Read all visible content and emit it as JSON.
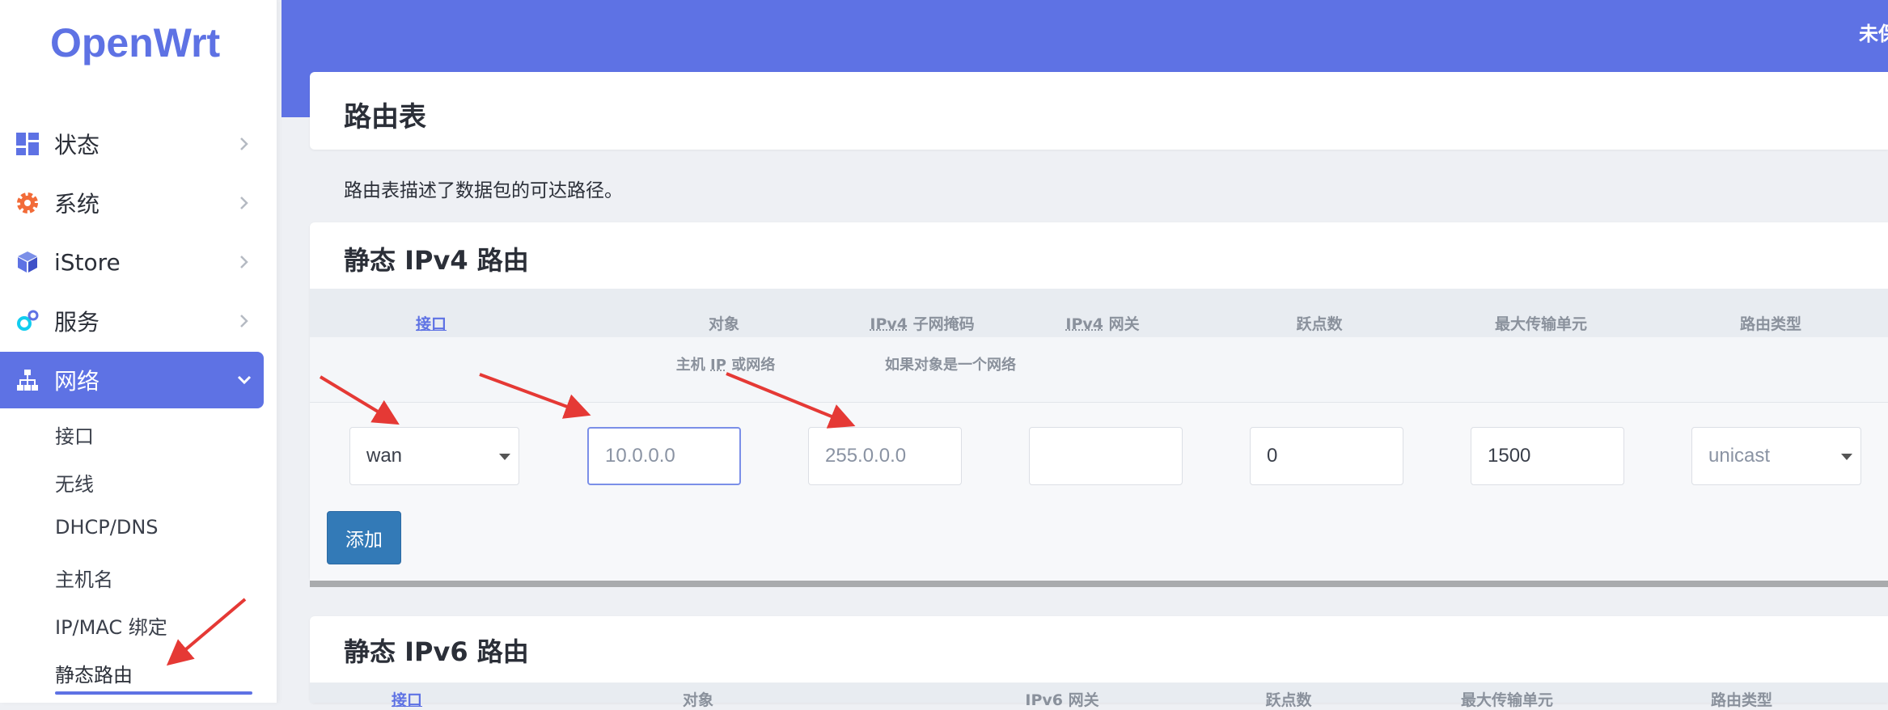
{
  "app": {
    "logo": "OpenWrt",
    "topbar_text": "未保存"
  },
  "sidebar": {
    "menu": [
      {
        "label": "状态",
        "icon": "dashboard-icon"
      },
      {
        "label": "系统",
        "icon": "gear-icon"
      },
      {
        "label": "iStore",
        "icon": "cube-icon"
      },
      {
        "label": "服务",
        "icon": "services-icon"
      },
      {
        "label": "网络",
        "icon": "network-icon",
        "active": true
      }
    ],
    "submenu": [
      {
        "label": "接口"
      },
      {
        "label": "无线"
      },
      {
        "label": "DHCP/DNS"
      },
      {
        "label": "主机名"
      },
      {
        "label": "IP/MAC 绑定"
      },
      {
        "label": "静态路由",
        "active": true
      }
    ]
  },
  "page": {
    "title": "路由表",
    "description": "路由表描述了数据包的可达路径。"
  },
  "ipv4": {
    "title": "静态 IPv4 路由",
    "headers": {
      "interface": "接口",
      "target": "对象",
      "netmask_abbr": "IPv4",
      "netmask": " 子网掩码",
      "gateway_abbr": "IPv4",
      "gateway": " 网关",
      "metric": "跃点数",
      "mtu": "最大传输单元",
      "type": "路由类型"
    },
    "subheaders": {
      "target_pre": "主机 ",
      "target_abbr": "IP",
      "target_post": " 或网络",
      "netmask": "如果对象是一个网络"
    },
    "row": {
      "interface": "wan",
      "target_placeholder": "10.0.0.0",
      "netmask_placeholder": "255.0.0.0",
      "gateway": "",
      "metric": "0",
      "mtu": "1500",
      "type": "unicast"
    },
    "add_button": "添加"
  },
  "ipv6": {
    "title": "静态 IPv6 路由",
    "headers": [
      "接口",
      "对象",
      "IPv6 网关",
      "跃点数",
      "最大传输单元",
      "路由类型"
    ]
  },
  "colors": {
    "accent": "#5e72e4",
    "button": "#337ab7",
    "annotation": "#e53935"
  }
}
